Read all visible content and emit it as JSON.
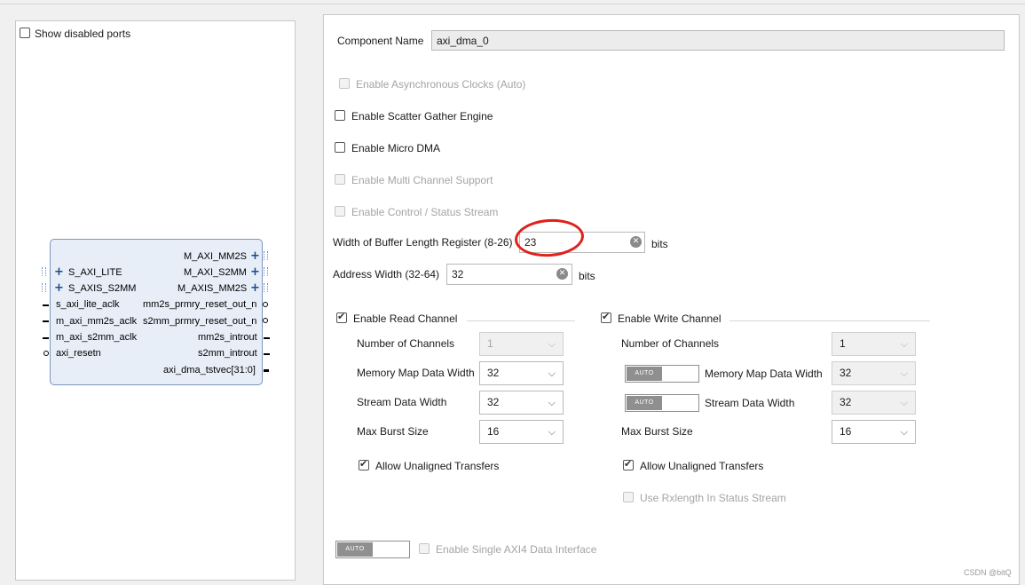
{
  "symbol_pane": {
    "show_disabled_ports": {
      "label": "Show disabled ports",
      "checked": false
    },
    "block": {
      "right_bus_ports": [
        "M_AXI_MM2S",
        "M_AXI_S2MM",
        "M_AXIS_MM2S"
      ],
      "left_bus_ports": [
        "S_AXI_LITE",
        "S_AXIS_S2MM"
      ],
      "left_pins": [
        "s_axi_lite_aclk",
        "m_axi_mm2s_aclk",
        "m_axi_s2mm_aclk",
        "axi_resetn"
      ],
      "right_pins": [
        "mm2s_prmry_reset_out_n",
        "s2mm_prmry_reset_out_n",
        "mm2s_introut",
        "s2mm_introut",
        "axi_dma_tstvec[31:0]"
      ]
    }
  },
  "config": {
    "component_name": {
      "label": "Component Name",
      "value": "axi_dma_0"
    },
    "async_clocks": {
      "label": "Enable Asynchronous Clocks (Auto)",
      "checked": false,
      "enabled": false
    },
    "scatter_gather": {
      "label": "Enable Scatter Gather Engine",
      "checked": false
    },
    "micro_dma": {
      "label": "Enable Micro DMA",
      "checked": false
    },
    "multi_channel": {
      "label": "Enable Multi Channel Support",
      "checked": false,
      "enabled": false
    },
    "control_status": {
      "label": "Enable Control / Status Stream",
      "checked": false,
      "enabled": false
    },
    "buffer_length": {
      "label": "Width of Buffer Length Register (8-26)",
      "value": "23",
      "unit": "bits"
    },
    "address_width": {
      "label": "Address Width (32-64)",
      "value": "32",
      "unit": "bits"
    },
    "read_channel": {
      "label": "Enable Read Channel",
      "checked": true,
      "num_channels": {
        "label": "Number of Channels",
        "value": "1"
      },
      "mm_data_width": {
        "label": "Memory Map Data Width",
        "value": "32"
      },
      "stream_data_width": {
        "label": "Stream Data Width",
        "value": "32"
      },
      "max_burst": {
        "label": "Max Burst Size",
        "value": "16"
      },
      "unaligned": {
        "label": "Allow Unaligned Transfers",
        "checked": true
      }
    },
    "write_channel": {
      "label": "Enable Write Channel",
      "checked": true,
      "num_channels": {
        "label": "Number of Channels",
        "value": "1"
      },
      "mm_data_width": {
        "label": "Memory Map Data Width",
        "value": "32"
      },
      "stream_data_width": {
        "label": "Stream Data Width",
        "value": "32"
      },
      "max_burst": {
        "label": "Max Burst Size",
        "value": "16"
      },
      "unaligned": {
        "label": "Allow Unaligned Transfers",
        "checked": true
      },
      "rxlength": {
        "label": "Use Rxlength In Status Stream",
        "checked": false,
        "enabled": false
      }
    },
    "auto_label": "AUTO",
    "single_axi4": {
      "label": "Enable Single AXI4 Data Interface",
      "checked": false,
      "enabled": false
    }
  },
  "watermark": "CSDN @bitQ",
  "colors": {
    "highlight_ellipse": "#e0201c",
    "block_fill": "#e8eef8",
    "block_border": "#7c95bf"
  }
}
